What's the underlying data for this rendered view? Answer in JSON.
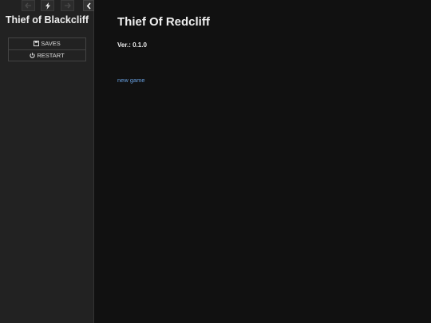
{
  "sidebar": {
    "story_title": "Thief of Blackcliff",
    "history": {
      "back_icon": "arrow-left-icon",
      "jump_icon": "lightning-icon",
      "forward_icon": "arrow-right-icon",
      "toggle_icon": "chevron-left-icon"
    },
    "menu": [
      {
        "label": "SAVES",
        "icon": "save-icon"
      },
      {
        "label": "RESTART",
        "icon": "power-icon"
      }
    ]
  },
  "passage": {
    "title": "Thief Of Redcliff",
    "version": "Ver.: 0.1.0",
    "new_game_link": "new game"
  },
  "colors": {
    "sidebar_bg": "#222222",
    "main_bg": "#111111",
    "link": "#68a0e0",
    "text": "#eeeeee"
  }
}
